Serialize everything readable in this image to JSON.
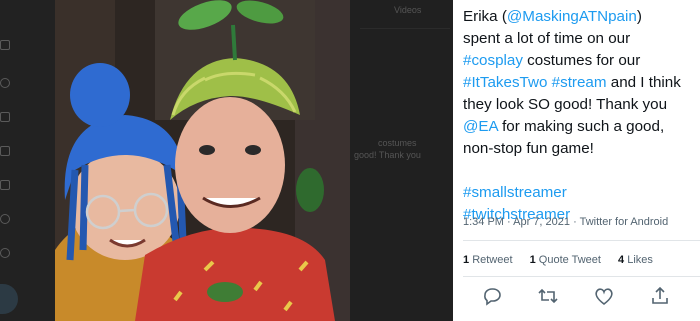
{
  "photo": {
    "alt_icon": "cosplay-selfie"
  },
  "background": {
    "videos_label": "Videos",
    "snippet_line1": "costumes",
    "snippet_line2": "good! Thank you"
  },
  "tweet": {
    "author_name": "Erika",
    "author_handle": "@MaskingATNpain",
    "text_1": " spent a lot of time on our ",
    "tag_cosplay": "#cosplay",
    "text_2": " costumes for our ",
    "tag_ittakestwo": "#ItTakesTwo",
    "tag_stream": "#stream",
    "text_3": " and I think they look SO good! Thank you ",
    "mention_ea": "@EA",
    "text_4": " for making such a good, non-stop fun game!",
    "tag_smallstreamer": "#smallstreamer",
    "tag_twitchstreamer": "#twitchstreamer",
    "timestamp": "1:34 PM · Apr 7, 2021 · Twitter for Android"
  },
  "stats": {
    "retweets_count": "1",
    "retweets_label": "Retweet",
    "quotes_count": "1",
    "quotes_label": "Quote Tweet",
    "likes_count": "4",
    "likes_label": "Likes"
  },
  "actions": {
    "reply_icon": "reply-icon",
    "retweet_icon": "retweet-icon",
    "like_icon": "heart-icon",
    "share_icon": "share-icon"
  },
  "colors": {
    "link": "#1d9bf0",
    "text": "#0f1419",
    "muted": "#536471"
  }
}
